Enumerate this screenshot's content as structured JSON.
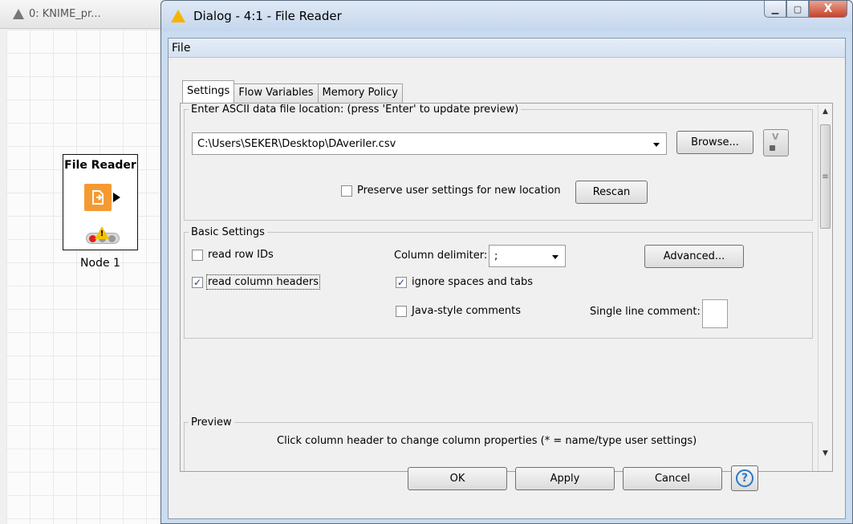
{
  "background": {
    "tab_label": "0: KNIME_pr...",
    "node": {
      "title": "File Reader",
      "label": "Node 1",
      "warning_mark": "!"
    }
  },
  "dialog": {
    "title": "Dialog - 4:1 - File Reader",
    "window_buttons": {
      "minimize": "▁",
      "maximize": "▢",
      "close": "X"
    },
    "menu": {
      "file": "File"
    },
    "tabs": [
      {
        "label": "Settings",
        "active": true
      },
      {
        "label": "Flow Variables",
        "active": false
      },
      {
        "label": "Memory Policy",
        "active": false
      }
    ],
    "location": {
      "legend": "Enter ASCII data file location: (press 'Enter' to update preview)",
      "path": "C:\\Users\\SEKER\\Desktop\\DAveriler.csv",
      "browse_label": "Browse...",
      "preserve_label": "Preserve user settings for new location",
      "preserve_checked": false,
      "rescan_label": "Rescan"
    },
    "basic": {
      "legend": "Basic Settings",
      "read_row_ids_label": "read row IDs",
      "read_row_ids_checked": false,
      "read_col_headers_label": "read column headers",
      "read_col_headers_checked": true,
      "col_delim_label": "Column delimiter:",
      "col_delim_value": ";",
      "ignore_spaces_label": "ignore spaces and tabs",
      "ignore_spaces_checked": true,
      "java_comments_label": "Java-style comments",
      "java_comments_checked": false,
      "advanced_label": "Advanced...",
      "single_line_comment_label": "Single line comment:",
      "single_line_comment_value": ""
    },
    "preview": {
      "legend": "Preview",
      "hint": "Click column header to change column properties (* = name/type user settings)"
    },
    "footer": {
      "ok_label": "OK",
      "apply_label": "Apply",
      "cancel_label": "Cancel",
      "help_label": "?"
    },
    "scroll": {
      "up": "▲",
      "down": "▼",
      "grip": "≡"
    }
  },
  "colors": {
    "title_bar": "#c4d6ec",
    "node_orange": "#f59a33",
    "close_red": "#c7432a",
    "check_blue": "#1a3a8a"
  }
}
